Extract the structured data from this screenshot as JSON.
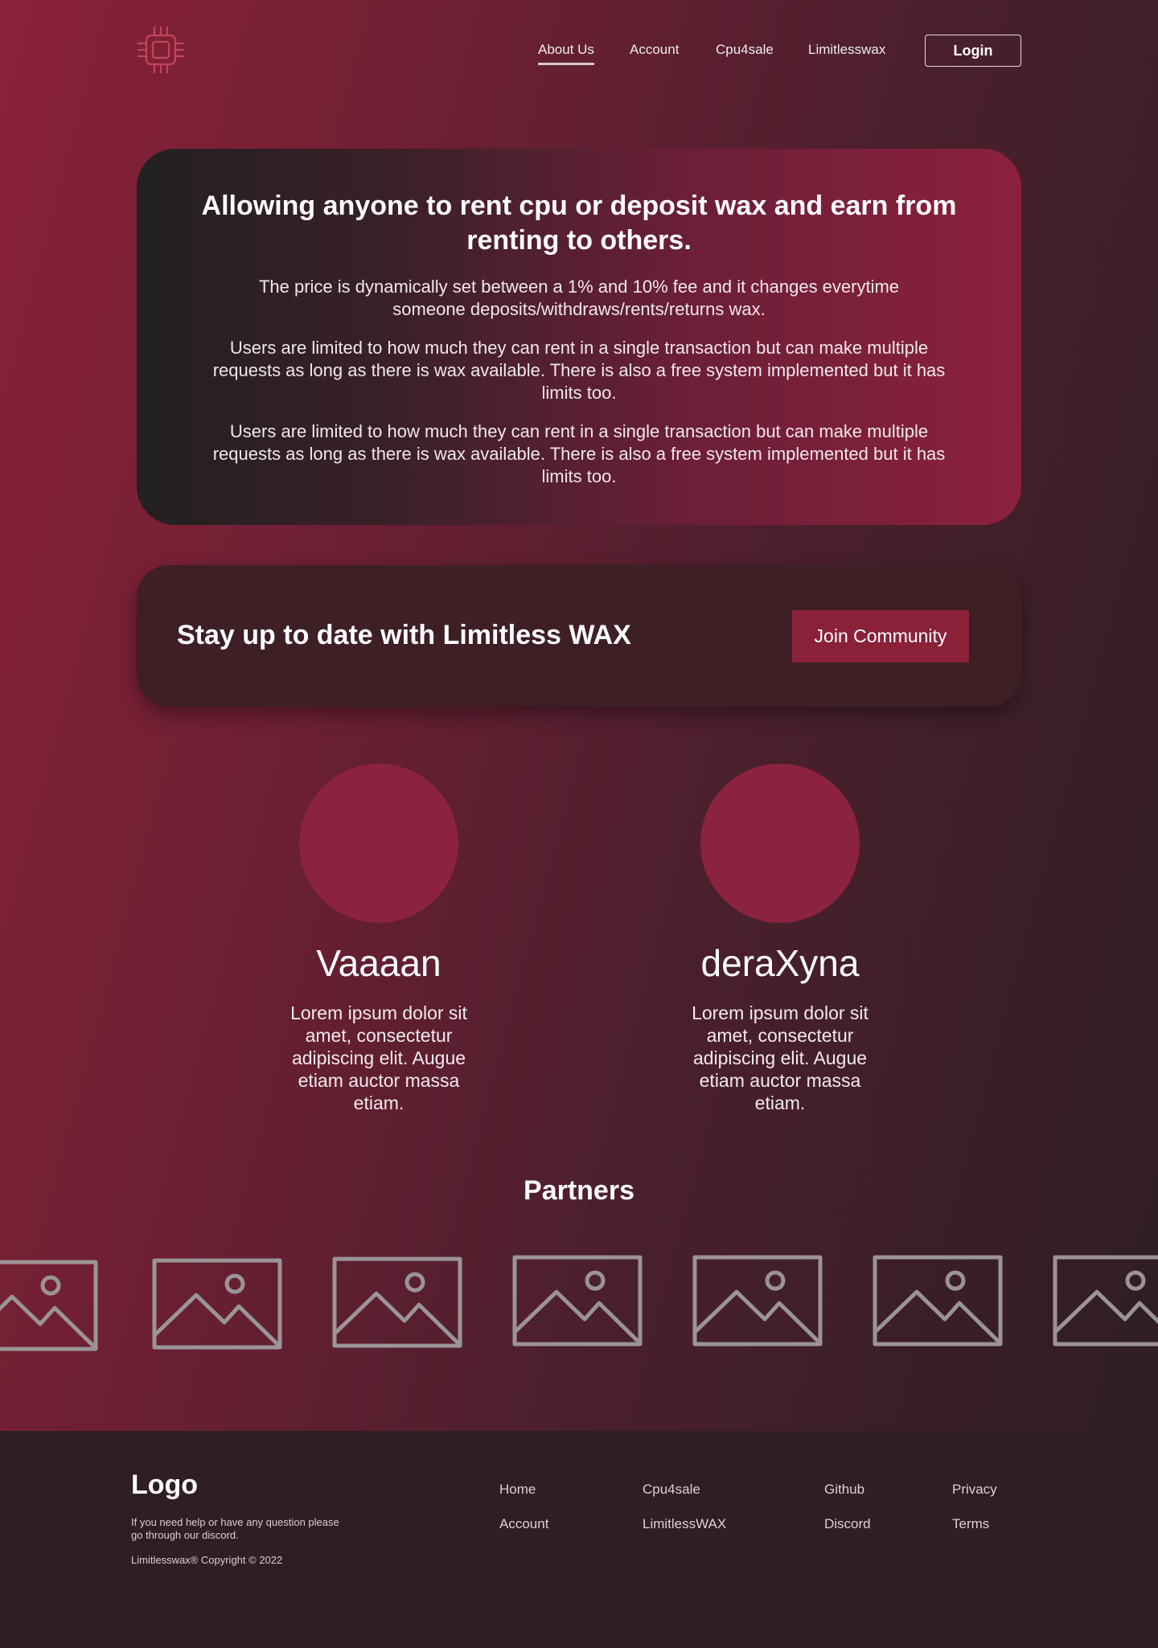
{
  "colors": {
    "accent": "#8a2139",
    "background_dark": "#2f1e22",
    "card_dark": "#3e1f26",
    "logo_outline": "#c2455a"
  },
  "header": {
    "logo_icon": "cpu-chip-icon",
    "nav": [
      {
        "label": "About Us",
        "active": true
      },
      {
        "label": "Account"
      },
      {
        "label": "Cpu4sale"
      },
      {
        "label": "Limitlesswax"
      }
    ],
    "login_label": "Login"
  },
  "hero": {
    "title": "Allowing anyone to rent cpu or deposit wax and earn from renting to others.",
    "paragraphs": [
      "The price is dynamically set between a 1% and 10% fee and it changes everytime someone deposits/withdraws/rents/returns wax.",
      "Users are limited to how much they can rent in a single transaction but can make multiple requests as long as there is wax available. There is also a free system implemented but it has limits too.",
      "Users are limited to how much they can rent in a single transaction but can make multiple requests as long as there is wax available. There is also a free system implemented but it has limits too."
    ]
  },
  "community": {
    "heading": "Stay up to date with Limitless WAX",
    "button_label": "Join Community"
  },
  "team": [
    {
      "name": "Vaaaan",
      "bio": "Lorem ipsum dolor sit amet, consectetur adipiscing elit. Augue etiam auctor massa etiam."
    },
    {
      "name": "deraXyna",
      "bio": "Lorem ipsum dolor sit amet, consectetur adipiscing elit. Augue etiam auctor massa etiam."
    }
  ],
  "partners": {
    "title": "Partners",
    "items": [
      "image-placeholder-icon",
      "image-placeholder-icon",
      "image-placeholder-icon",
      "image-placeholder-icon",
      "image-placeholder-icon",
      "image-placeholder-icon",
      "image-placeholder-icon"
    ]
  },
  "footer": {
    "logo": "Logo",
    "help_text": "If you need help or have any question please go through our discord.",
    "copyright": "Limitlesswax® Copyright © 2022",
    "links": [
      {
        "label": "Home"
      },
      {
        "label": "Account"
      },
      {
        "label": "Cpu4sale"
      },
      {
        "label": "LimitlessWAX"
      },
      {
        "label": "Github"
      },
      {
        "label": "Discord"
      },
      {
        "label": "Privacy"
      },
      {
        "label": "Terms"
      }
    ]
  }
}
